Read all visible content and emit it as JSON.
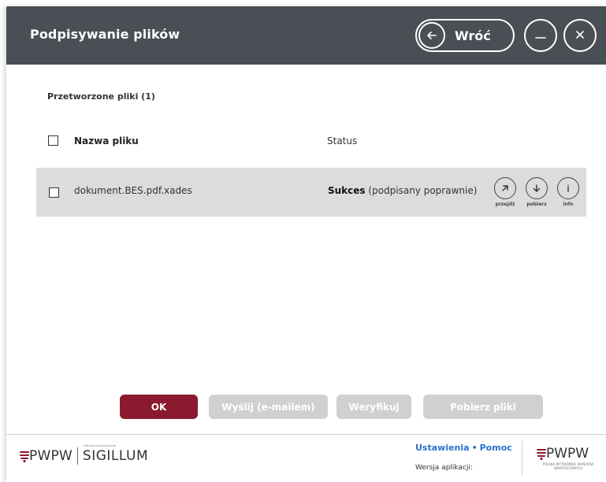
{
  "window": {
    "title": "Podpisywanie plików",
    "back_label": "Wróć",
    "icons": {
      "back": "arrow-left-icon",
      "minimize": "minimize-icon",
      "close": "close-icon"
    }
  },
  "files": {
    "section_title": "Przetworzone pliki (1)",
    "columns": {
      "name": "Nazwa pliku",
      "status": "Status"
    },
    "rows": [
      {
        "name": "dokument.BES.pdf.xades",
        "status_bold": "Sukces",
        "status_detail": "(podpisany poprawnie)",
        "actions": [
          {
            "label": "przejdź",
            "icon": "arrow-up-right-icon"
          },
          {
            "label": "pobierz",
            "icon": "arrow-down-icon"
          },
          {
            "label": "info",
            "icon": "info-icon"
          }
        ]
      }
    ]
  },
  "buttons": {
    "ok": "OK",
    "send": "Wyślij (e-mailem)",
    "verify": "Weryfikuj",
    "download": "Pobierz pliki"
  },
  "footer": {
    "logo_left": {
      "pwpw": "PWPW",
      "sigillum_small": "CENTRUM KWALIFIKOWANE",
      "sigillum": "SIGILLUM"
    },
    "settings_link": "Ustawienia",
    "help_link": "Pomoc",
    "version_label": "Wersja aplikacji:",
    "logo_right": {
      "pwpw": "PWPW",
      "subtitle": "POLSKA WYTWÓRNIA PAPIERÓW WARTOŚCIOWYCH"
    }
  },
  "colors": {
    "titlebar": "#4a4f55",
    "primary": "#8b1a2e",
    "disabled": "#d0d0d0",
    "link": "#2a72c8",
    "row_bg": "#dcdcdc"
  }
}
